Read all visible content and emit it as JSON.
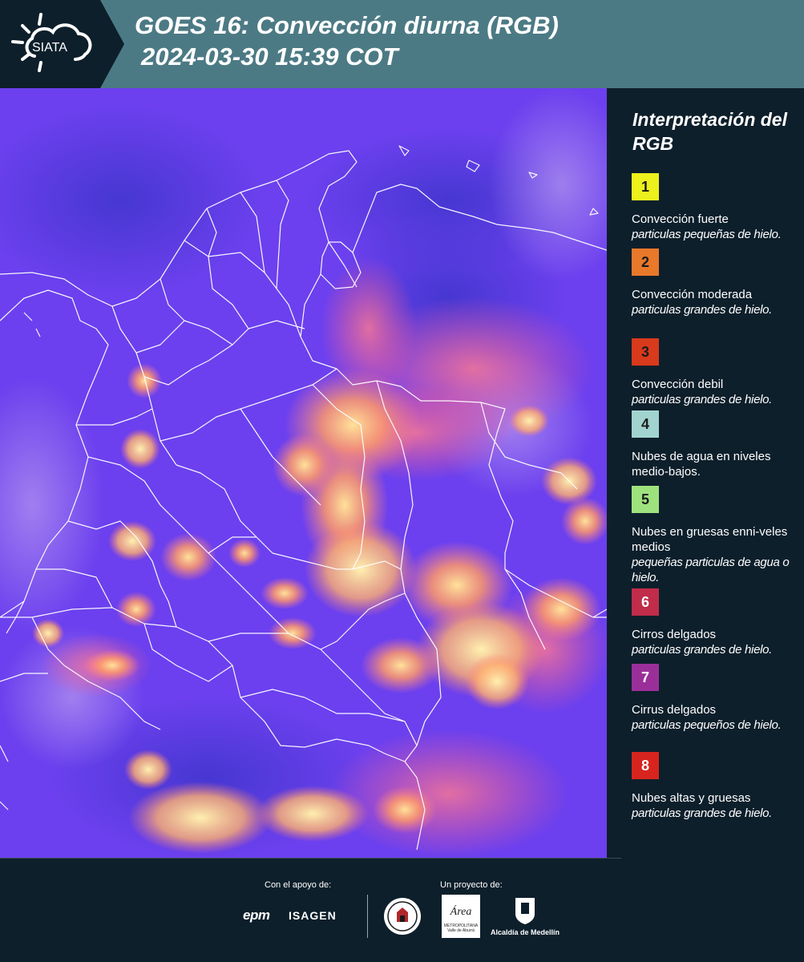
{
  "header": {
    "logo_text": "SIATA",
    "title_line1": "GOES 16: Convección diurna (RGB)",
    "title_line2": "2024-03-30 15:39 COT",
    "background_color": "#4c7a84"
  },
  "map": {
    "background_color": "#6a3ef0",
    "description_colors": [
      "#6a3ef0",
      "#ff8a5c",
      "#ffd27a",
      "#ff5c8a"
    ]
  },
  "legend": {
    "title": "Interpretación del RGB",
    "items": [
      {
        "number": "1",
        "color": "#ecf01c",
        "label": "Convección fuerte",
        "sub": "particulas pequeñas de hielo."
      },
      {
        "number": "2",
        "color": "#e8782a",
        "label": "Convección moderada",
        "sub": "particulas grandes de hielo."
      },
      {
        "number": "3",
        "color": "#d83a1c",
        "label": "Convección debil",
        "sub": "particulas grandes de hielo."
      },
      {
        "number": "4",
        "color": "#a2d4cf",
        "label": "Nubes de agua en niveles medio-bajos.",
        "sub": ""
      },
      {
        "number": "5",
        "color": "#9ee27e",
        "label": "Nubes en gruesas enni-veles medios",
        "sub": "pequeñas particulas de agua o hielo."
      },
      {
        "number": "6",
        "color": "#c02c4a",
        "label": "Cirros delgados",
        "sub": "particulas grandes de hielo."
      },
      {
        "number": "7",
        "color": "#9b2f9a",
        "label": "Cirrus delgados",
        "sub": "particulas pequeños de hielo."
      },
      {
        "number": "8",
        "color": "#d8241e",
        "label": "Nubes altas y gruesas",
        "sub": "particulas grandes de hielo."
      }
    ]
  },
  "footer": {
    "support_label": "Con el apoyo de:",
    "project_label": "Un proyecto de:",
    "epm": "epm",
    "isagen": "ISAGEN",
    "area_logo": "Área",
    "area_sub": "METROPOLITANA Valle de Aburrá",
    "alcaldia": "Alcaldía de Medellín"
  }
}
